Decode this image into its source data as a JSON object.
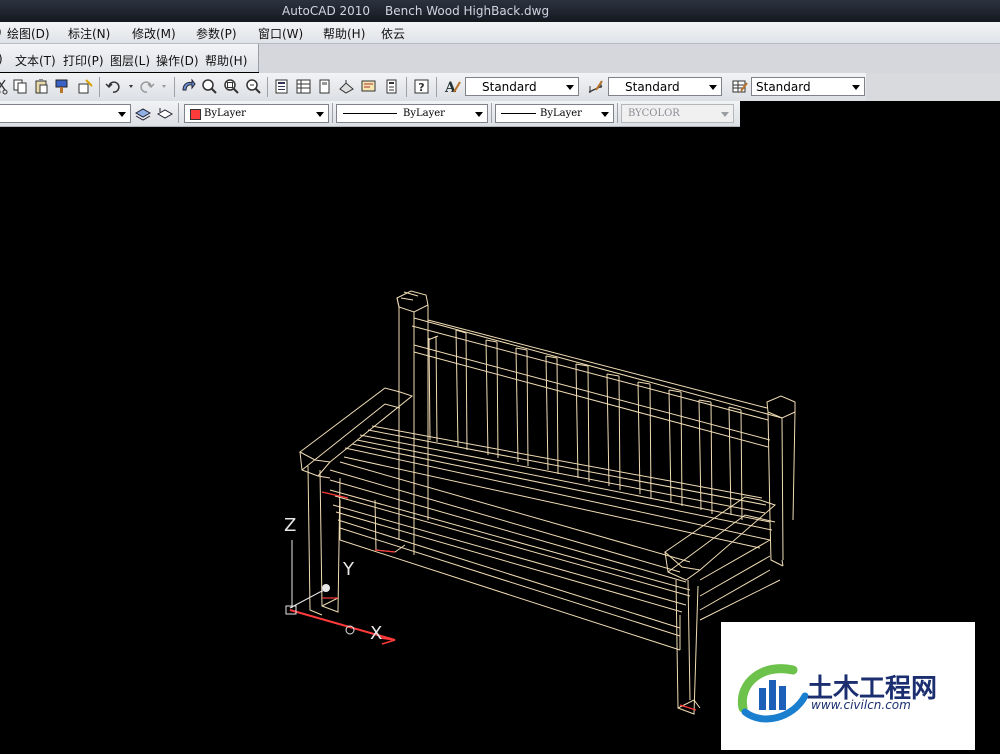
{
  "window": {
    "app_name": "AutoCAD 2010",
    "file_name": "Bench Wood HighBack.dwg"
  },
  "menu_row1": [
    "绘图(D)",
    "标注(N)",
    "修改(M)",
    "参数(P)",
    "窗口(W)",
    "帮助(H)",
    "依云"
  ],
  "menu_row2": [
    "文本(T)",
    "打印(P)",
    "图层(L)",
    "操作(D)",
    "帮助(H)"
  ],
  "styles_toolbar": {
    "text_style": "Standard",
    "dim_style": "Standard",
    "table_style": "Standard"
  },
  "properties_toolbar": {
    "color": "ByLayer",
    "linetype": "ByLayer",
    "lineweight": "ByLayer",
    "plot_style": "BYCOLOR"
  },
  "ucs": {
    "x_label": "X",
    "y_label": "Y",
    "z_label": "Z"
  },
  "watermark": {
    "brand": "土木工程网",
    "url": "www.civilcn.com"
  },
  "colors": {
    "wireframe": "#f0dcb4",
    "accent_red": "#ff3b3b",
    "background": "#000000"
  }
}
